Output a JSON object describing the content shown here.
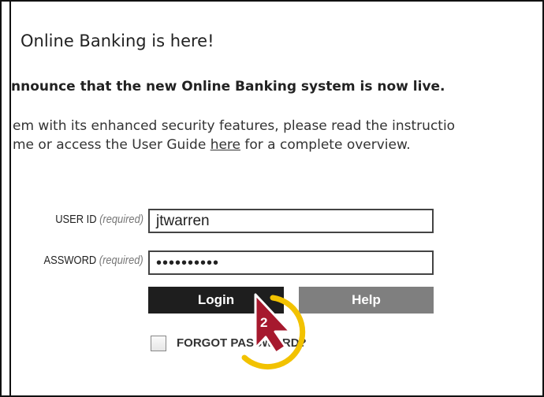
{
  "page": {
    "title": "Online Banking is here!",
    "announcement": "nnounce that the new Online Banking system is now live.",
    "body_line1": "em with its enhanced security features, please read the instructio",
    "body_line2_before": "me or access the User Guide ",
    "body_link": "here",
    "body_line2_after": " for a complete overview."
  },
  "form": {
    "user_label": "USER ID",
    "user_required": "(required)",
    "user_value": "jtwarren",
    "pass_label": "ASSWORD",
    "pass_required": "(required)",
    "pass_value": "••••••••••",
    "login_label": "Login",
    "help_label": "Help",
    "forgot_label": "FORGOT PASSWORD?"
  },
  "annotation": {
    "step_number": "2",
    "accent_color": "#a6192e",
    "ring_color": "#f2c200"
  }
}
